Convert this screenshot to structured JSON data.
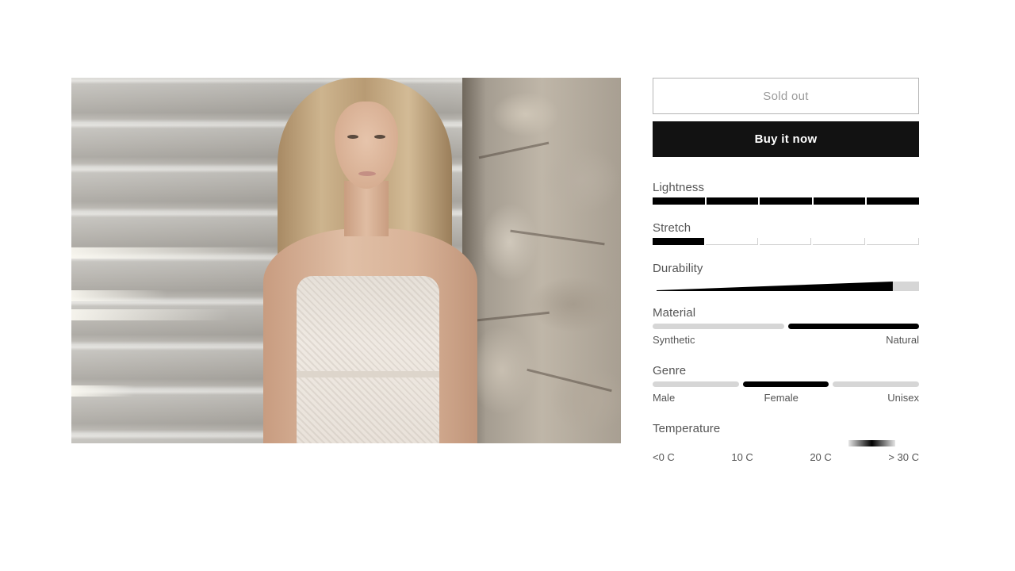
{
  "product": {
    "image_alt": "Woman with long blonde hair in a white crochet dress leaning against a stone wall beside concrete stairs"
  },
  "buttons": {
    "sold_out_label": "Sold out",
    "buy_now_label": "Buy it now"
  },
  "attributes": {
    "lightness": {
      "label": "Lightness",
      "scale_steps": 5,
      "value": 5
    },
    "stretch": {
      "label": "Stretch",
      "scale_steps": 5,
      "value": 1
    },
    "durability": {
      "label": "Durability",
      "value_fraction": 0.9
    },
    "material": {
      "label": "Material",
      "options": [
        "Synthetic",
        "Natural"
      ],
      "selected": "Natural"
    },
    "genre": {
      "label": "Genre",
      "options": [
        "Male",
        "Female",
        "Unisex"
      ],
      "selected": "Female"
    },
    "temperature": {
      "label": "Temperature",
      "ticks": [
        "<0 C",
        "10 C",
        "20 C",
        "> 30 C"
      ],
      "range_start_c": 24,
      "range_peak_c": 27,
      "range_end_c": 30
    }
  },
  "colors": {
    "accent": "#121212",
    "inactive": "#d6d6d6",
    "muted_text": "#9a9a9a",
    "text": "#555555"
  }
}
